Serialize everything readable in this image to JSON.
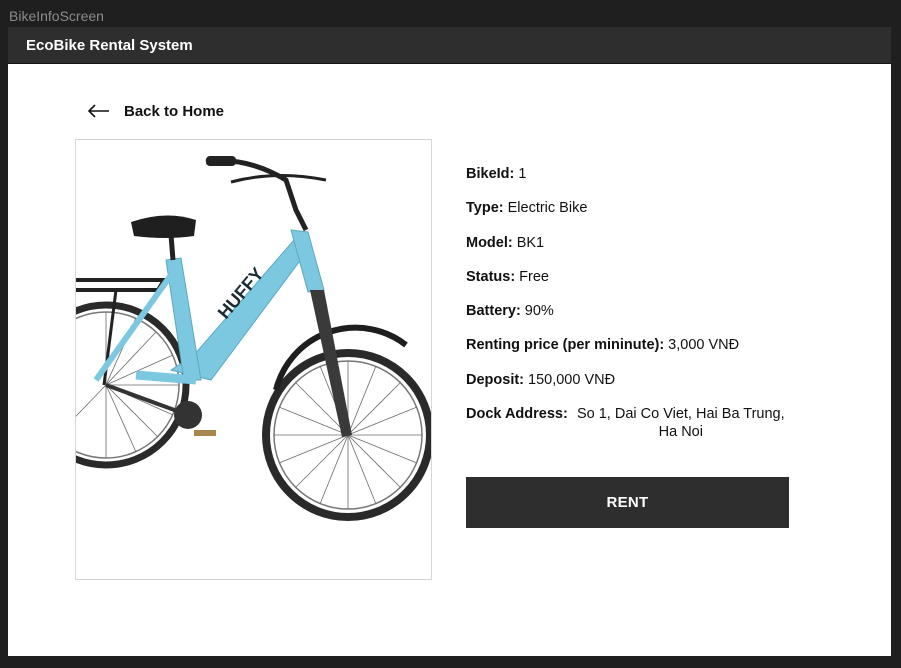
{
  "frame_label": "BikeInfoScreen",
  "window": {
    "title": "EcoBike Rental System"
  },
  "nav": {
    "back_label": "Back to Home",
    "back_icon": "arrow-left-icon"
  },
  "bike": {
    "image_icon": "bicycle-photo",
    "fields": [
      {
        "key": "BikeId:",
        "value": "1"
      },
      {
        "key": "Type:",
        "value": "Electric Bike"
      },
      {
        "key": "Model:",
        "value": "BK1"
      },
      {
        "key": "Status:",
        "value": "Free"
      },
      {
        "key": "Battery:",
        "value": "90%"
      },
      {
        "key": "Renting price (per mininute):",
        "value": "3,000 VNĐ"
      },
      {
        "key": "Deposit:",
        "value": "150,000 VNĐ"
      },
      {
        "key": "Dock Address:",
        "value": "So 1, Dai Co Viet, Hai Ba Trung, Ha Noi"
      }
    ]
  },
  "actions": {
    "rent_label": "RENT"
  },
  "colors": {
    "titlebar": "#2e2e2e",
    "button": "#2e2e2e",
    "frame": "#1f1f1f",
    "bike_frame": "#7cc8e0"
  }
}
